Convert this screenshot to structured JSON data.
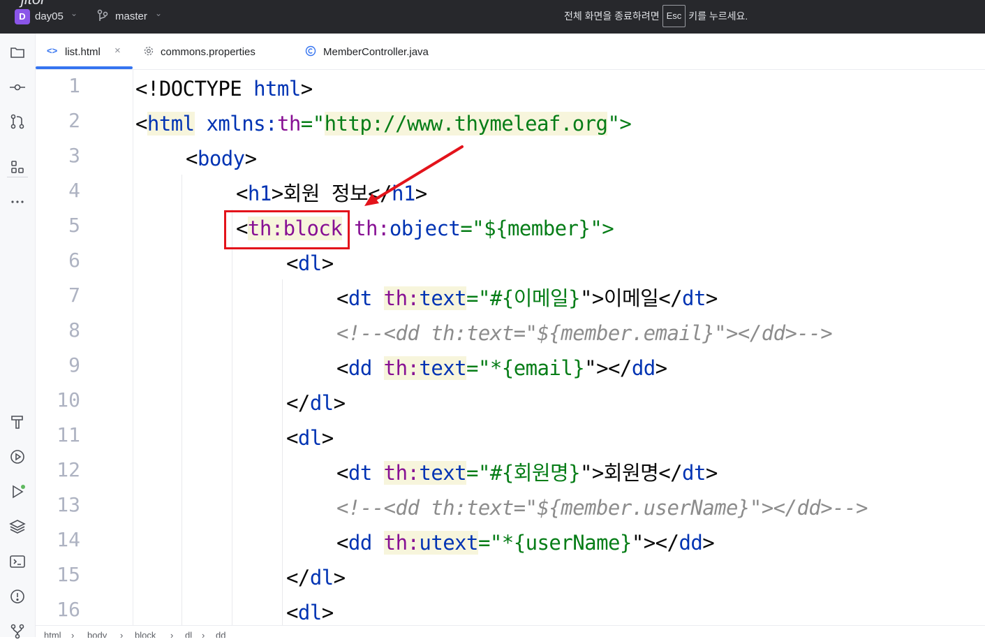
{
  "titlebar": {
    "app_logo_text": "jitor",
    "project_badge": "D",
    "project_name": "day05",
    "branch": "master",
    "fullscreen_msg_pre": "전체 화면을 종료하려면",
    "fullscreen_key": "Esc",
    "fullscreen_msg_post": "키를 누르세요."
  },
  "left_tools": [
    "project-folder-icon",
    "commit-icon",
    "pull-requests-icon",
    "structure-icon",
    "more-icon",
    "build-hammer-icon",
    "services-icon",
    "run-icon",
    "layers-icon",
    "terminal-icon",
    "problems-icon",
    "git-icon"
  ],
  "tabs": [
    {
      "label": "list.html",
      "icon": "html-icon",
      "active": true,
      "closable": true
    },
    {
      "label": "commons.properties",
      "icon": "gear-icon",
      "active": false
    },
    {
      "label": "MemberController.java",
      "icon": "class-icon",
      "active": false
    }
  ],
  "tab_close_glyph": "×",
  "line_numbers": [
    "1",
    "2",
    "3",
    "4",
    "5",
    "6",
    "7",
    "8",
    "9",
    "10",
    "11",
    "12",
    "13",
    "14",
    "15",
    "16"
  ],
  "code": {
    "l1": {
      "lt": "<!DOCTYPE ",
      "name": "html",
      "gt": ">"
    },
    "l2": {
      "lt": "<",
      "tag": "html",
      "sp": " ",
      "attr_ns": "xmlns:",
      "attr": "th",
      "eq": "=\"",
      "val": "http://www.thymeleaf.org",
      "end": "\">"
    },
    "l3": {
      "lt": "<",
      "tag": "body",
      "gt": ">"
    },
    "l4": {
      "lt": "<",
      "tag": "h1",
      "gt": ">",
      "text": "회원 정보",
      "close_lt": "</",
      "close_tag": "h1",
      "close_gt": ">"
    },
    "l5": {
      "lt": "<",
      "tag": "th:block",
      "sp": " ",
      "attr_ns": "th:",
      "attr": "object",
      "eq": "=\"",
      "val": "${member}",
      "end": "\">"
    },
    "l6": {
      "lt": "<",
      "tag": "dl",
      "gt": ">"
    },
    "l7": {
      "lt": "<",
      "tag": "dt",
      "sp": " ",
      "attr_ns": "th:",
      "attr": "text",
      "eq": "=\"",
      "val": "#{이메일}",
      "mid": "\">",
      "text": "이메일",
      "close_lt": "</",
      "close_tag": "dt",
      "close_gt": ">"
    },
    "l8": {
      "comment": "<!--<dd th:text=\"${member.email}\"></dd>-->"
    },
    "l9": {
      "lt": "<",
      "tag": "dd",
      "sp": " ",
      "attr_ns": "th:",
      "attr": "text",
      "eq": "=\"",
      "val": "*{email}",
      "mid": "\">",
      "close_lt": "</",
      "close_tag": "dd",
      "close_gt": ">"
    },
    "l10": {
      "lt": "</",
      "tag": "dl",
      "gt": ">"
    },
    "l11": {
      "lt": "<",
      "tag": "dl",
      "gt": ">"
    },
    "l12": {
      "lt": "<",
      "tag": "dt",
      "sp": " ",
      "attr_ns": "th:",
      "attr": "text",
      "eq": "=\"",
      "val": "#{회원명}",
      "mid": "\">",
      "text": "회원명",
      "close_lt": "</",
      "close_tag": "dt",
      "close_gt": ">"
    },
    "l13": {
      "comment": "<!--<dd th:text=\"${member.userName}\"></dd>-->"
    },
    "l14": {
      "lt": "<",
      "tag": "dd",
      "sp": " ",
      "attr_ns": "th:",
      "attr": "utext",
      "eq": "=\"",
      "val": "*{userName}",
      "mid": "\">",
      "close_lt": "</",
      "close_tag": "dd",
      "close_gt": ">"
    },
    "l15": {
      "lt": "</",
      "tag": "dl",
      "gt": ">"
    },
    "l16": {
      "lt": "<",
      "tag": "dl",
      "gt": ">"
    }
  },
  "breadcrumb": [
    "html",
    "body",
    "block",
    "dl",
    "dd"
  ],
  "breadcrumb_sep": "›",
  "colors": {
    "accent": "#3574f0",
    "annotation_red": "#e3131b",
    "tag": "#0033b3",
    "attr": "#871094",
    "string": "#067d17"
  }
}
